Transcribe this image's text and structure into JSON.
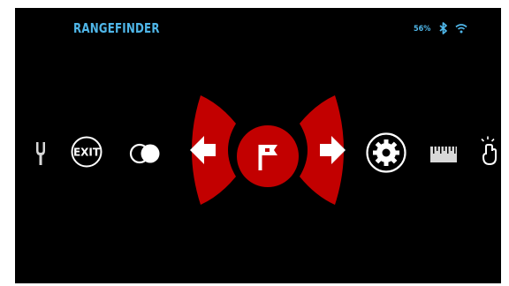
{
  "status_bar": {
    "title": "RANGEFINDER",
    "battery_percent": "56%",
    "bluetooth_icon": "bluetooth-icon",
    "wifi_icon": "wifi-icon"
  },
  "menu": {
    "items": [
      {
        "icon": "tuning-fork-icon"
      },
      {
        "icon": "exit-icon",
        "label": "EXIT"
      },
      {
        "icon": "toggle-circles-icon"
      },
      {
        "icon": "left-arrow-icon"
      },
      {
        "icon": "flag-icon",
        "selected": true
      },
      {
        "icon": "right-arrow-icon"
      },
      {
        "icon": "settings-gear-icon"
      },
      {
        "icon": "ruler-icon"
      },
      {
        "icon": "hand-tap-icon"
      }
    ]
  },
  "colors": {
    "accent": "#c20000",
    "title": "#4fb6e8",
    "icons": "#ffffff",
    "background": "#000000"
  }
}
